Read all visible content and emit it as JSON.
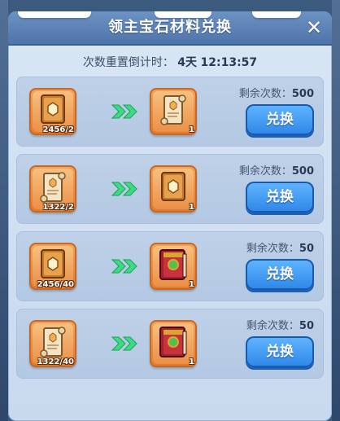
{
  "title": "领主宝石材料兑换",
  "close_label": "✕",
  "timer": {
    "label": "次数重置倒计时：",
    "days": "4天",
    "time": "12:13:57"
  },
  "rows": [
    {
      "input_icon": "gold-book-icon",
      "input_qty": "2456/2",
      "output_icon": "scroll-icon",
      "output_qty": "1",
      "count_label": "剩余次数：",
      "count_value": "500",
      "button": "兑换"
    },
    {
      "input_icon": "scroll-icon",
      "input_qty": "1322/2",
      "output_icon": "gold-book-icon",
      "output_qty": "1",
      "count_label": "剩余次数：",
      "count_value": "500",
      "button": "兑换"
    },
    {
      "input_icon": "gold-book-icon",
      "input_qty": "2456/40",
      "output_icon": "red-gem-book-icon",
      "output_qty": "1",
      "count_label": "剩余次数：",
      "count_value": "50",
      "button": "兑换"
    },
    {
      "input_icon": "scroll-icon",
      "input_qty": "1322/40",
      "output_icon": "red-gem-book-icon",
      "output_qty": "1",
      "count_label": "剩余次数：",
      "count_value": "50",
      "button": "兑换"
    }
  ],
  "colors": {
    "button_blue": "#2e86e8",
    "slot_orange": "#e07a2d",
    "arrow_green": "#3ddc84",
    "panel_header": "#5a80b6"
  }
}
